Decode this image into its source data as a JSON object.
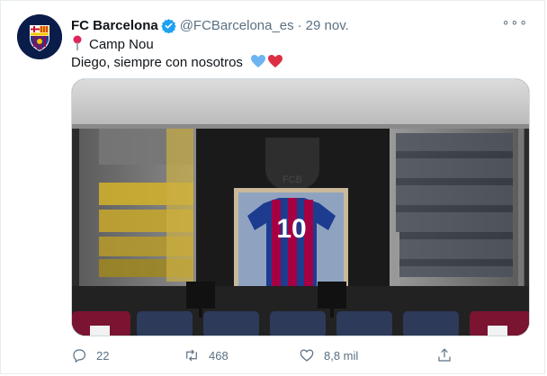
{
  "tweet": {
    "author_name": "FC Barcelona",
    "handle": "@FCBarcelona_es",
    "separator": "·",
    "date": "29 nov.",
    "location_text": "Camp Nou",
    "body_text": "Diego, siempre con nosotros",
    "more_label": "∘∘∘"
  },
  "media": {
    "jersey_number": "10",
    "crest_text": "FCB"
  },
  "actions": {
    "reply_count": "22",
    "retweet_count": "468",
    "like_count": "8,8 mil"
  },
  "colors": {
    "verified_blue": "#1da1f2",
    "secondary_text": "#5b7083",
    "barca_blue": "#1d3c8f",
    "barca_red": "#a50044"
  },
  "icons": [
    "verified-icon",
    "pin-icon",
    "blue-heart-icon",
    "red-heart-icon",
    "reply-icon",
    "retweet-icon",
    "like-icon",
    "share-icon"
  ]
}
